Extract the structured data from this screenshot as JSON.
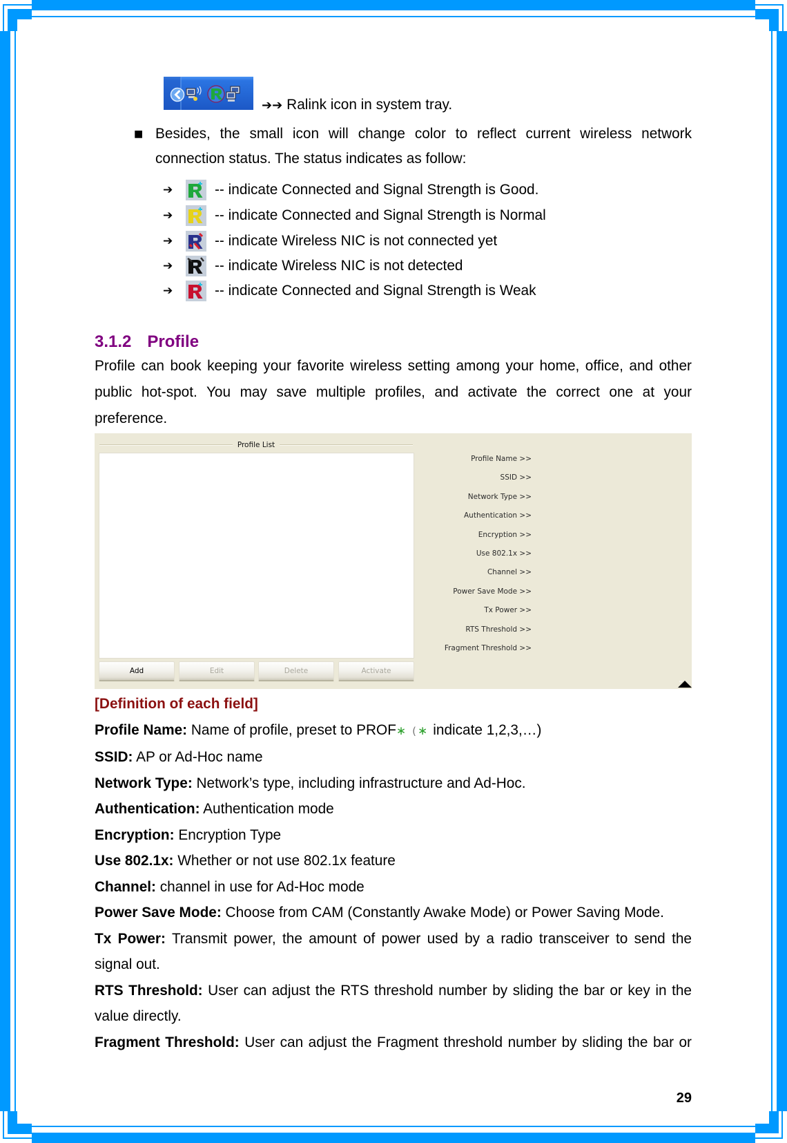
{
  "tray": {
    "caption_arrows": "➔➔",
    "caption_text": "Ralink icon in system tray."
  },
  "intro": {
    "bullet": "■",
    "text": "Besides, the small icon will change color to reflect current wireless network connection status. The status indicates as follow:"
  },
  "status_items": [
    {
      "arrow": "➔",
      "icon": "ralink-icon-green",
      "color": "#1fa83c",
      "accent": "#27c3e3",
      "text": "-- indicate Connected and Signal Strength is Good."
    },
    {
      "arrow": "➔",
      "icon": "ralink-icon-yellow",
      "color": "#e6d21a",
      "accent": "#27c3e3",
      "text": "-- indicate Connected and Signal Strength is Normal"
    },
    {
      "arrow": "➔",
      "icon": "ralink-icon-blue-red",
      "color": "#27308a",
      "accent": "#d8202e",
      "text": "-- indicate Wireless NIC is not connected yet"
    },
    {
      "arrow": "➔",
      "icon": "ralink-icon-black",
      "color": "#111111",
      "accent": "#333333",
      "text": "-- indicate Wireless NIC is not detected"
    },
    {
      "arrow": "➔",
      "icon": "ralink-icon-red",
      "color": "#c8102e",
      "accent": "#27c3e3",
      "text": "-- indicate Connected and Signal Strength is Weak"
    }
  ],
  "section": {
    "number": "3.1.2",
    "title": "Profile",
    "color": "#800080",
    "intro": "Profile can book keeping your favorite wireless setting among your home, office, and other public hot-spot. You may save multiple profiles, and activate the correct one at your preference."
  },
  "profile_window": {
    "group_title": "Profile List",
    "buttons": [
      {
        "label": "Add",
        "enabled": true
      },
      {
        "label": "Edit",
        "enabled": false
      },
      {
        "label": "Delete",
        "enabled": false
      },
      {
        "label": "Activate",
        "enabled": false
      }
    ],
    "fields": [
      "Profile Name >>",
      "SSID >>",
      "Network Type >>",
      "Authentication >>",
      "Encryption >>",
      "Use 802.1x >>",
      "Channel >>",
      "Power Save Mode >>",
      "Tx Power >>",
      "RTS Threshold >>",
      "Fragment Threshold >>"
    ]
  },
  "definitions": {
    "heading": "[Definition of each field]",
    "mark_color": "#2ca02c",
    "items": [
      {
        "term": "Profile Name:",
        "desc": "Name of profile, preset to PROF",
        "mark": "∗",
        "open": "(",
        "note": "indicate 1,2,3,…)"
      },
      {
        "term": "SSID:",
        "desc": "AP or Ad-Hoc name"
      },
      {
        "term": "Network Type:",
        "desc": "Network’s type, including infrastructure and Ad-Hoc."
      },
      {
        "term": "Authentication:",
        "desc": "Authentication mode"
      },
      {
        "term": "Encryption:",
        "desc": "Encryption Type"
      },
      {
        "term": "Use 802.1x:",
        "desc": "Whether or not use 802.1x feature"
      },
      {
        "term": "Channel:",
        "desc": "channel in use for Ad-Hoc mode"
      },
      {
        "term": "Power Save Mode:",
        "desc": "Choose from CAM (Constantly Awake Mode) or Power Saving Mode."
      },
      {
        "term": "Tx Power:",
        "desc": "Transmit power, the amount of power used by a radio transceiver to send the signal out."
      },
      {
        "term": "RTS Threshold:",
        "desc": "User can adjust the RTS threshold number by sliding the bar or key in the value directly."
      },
      {
        "term": "Fragment Threshold:",
        "desc": "User can adjust the Fragment threshold number by sliding the bar or"
      }
    ]
  },
  "page_number": "29"
}
